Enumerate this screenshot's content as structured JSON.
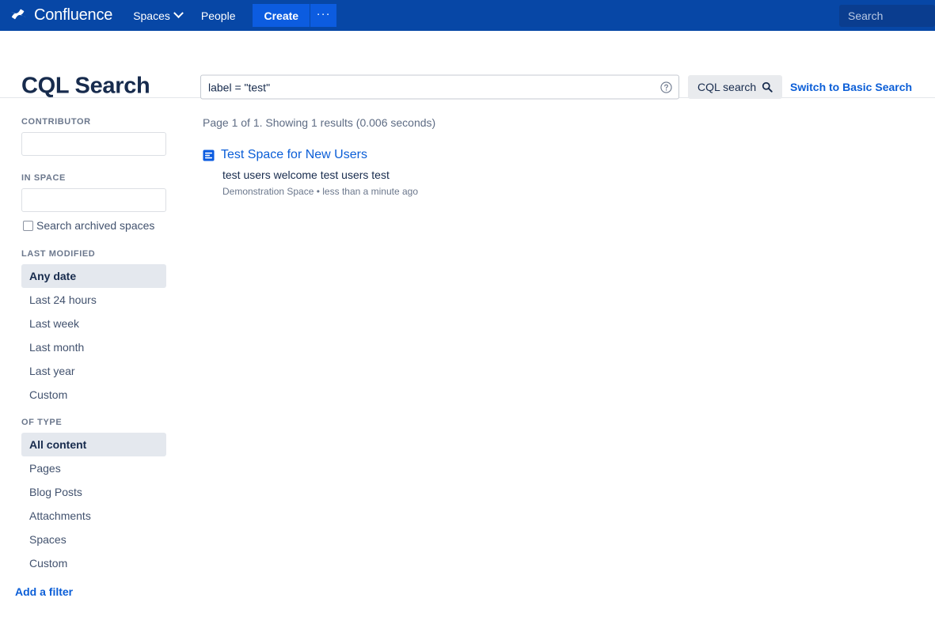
{
  "navbar": {
    "brand": "Confluence",
    "brand_logo_icon": "confluence-logo-icon",
    "items": [
      {
        "label": "Spaces",
        "has_chevron": true
      },
      {
        "label": "People",
        "has_chevron": false
      }
    ],
    "create_label": "Create",
    "more_label": "···",
    "search_placeholder": "Search",
    "search_value": "",
    "bg_color": "#0747A6",
    "create_color": "#0C5CE0"
  },
  "header": {
    "title": "CQL Search",
    "cql_value": "label = \"test\"",
    "cql_placeholder": "",
    "help_icon": "help-circle-icon",
    "search_button_label": "CQL search",
    "search_button_icon": "magnifier-icon",
    "switch_link": "Switch to Basic Search"
  },
  "sidebar": {
    "contributor": {
      "label": "CONTRIBUTOR",
      "value": "",
      "placeholder": ""
    },
    "in_space": {
      "label": "IN SPACE",
      "value": "",
      "placeholder": ""
    },
    "archived": {
      "label": "Search archived spaces",
      "checked": false
    },
    "last_modified": {
      "label": "LAST MODIFIED",
      "selected": "Any date",
      "options": [
        "Any date",
        "Last 24 hours",
        "Last week",
        "Last month",
        "Last year",
        "Custom"
      ]
    },
    "of_type": {
      "label": "OF TYPE",
      "selected": "All content",
      "options": [
        "All content",
        "Pages",
        "Blog Posts",
        "Attachments",
        "Spaces",
        "Custom"
      ]
    },
    "add_filter": "Add a filter"
  },
  "results": {
    "summary": "Page 1 of 1. Showing 1 results (0.006 seconds)",
    "items": [
      {
        "icon": "page-icon",
        "title": "Test Space for New Users",
        "excerpt": "test users welcome test users test",
        "space": "Demonstration Space",
        "separator": "•",
        "modified": "less than a minute ago",
        "meta": "Demonstration Space • less than a minute ago"
      }
    ]
  },
  "colors": {
    "nav_bg": "#0747A6",
    "link_blue": "#0B5ED7",
    "text_dark": "#172B4D",
    "text_muted": "#6B778C",
    "selected_bg": "#e4e8ee"
  }
}
